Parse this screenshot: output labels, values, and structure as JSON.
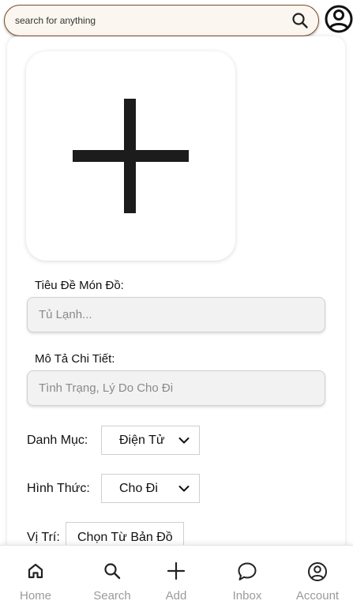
{
  "search": {
    "placeholder": "search for anything"
  },
  "icons": {
    "search": "search-icon",
    "account": "user-circle-icon",
    "upload": "plus-icon",
    "dropdown": "chevron-down-icon"
  },
  "form": {
    "title_label": "Tiêu Đề Món Đồ:",
    "title_placeholder": "Tủ Lạnh...",
    "description_label": "Mô Tả Chi Tiết:",
    "description_placeholder": "Tình Trạng, Lý Do Cho Đi",
    "category_label": "Danh Mục:",
    "category_value": "Điện Tử",
    "method_label": "Hình Thức:",
    "method_value": "Cho Đi",
    "location_label": "Vị Trí:",
    "location_button": "Chọn Từ Bản Đồ"
  },
  "nav": [
    {
      "label": "Home",
      "icon": "home-icon"
    },
    {
      "label": "Search",
      "icon": "search-icon"
    },
    {
      "label": "Add",
      "icon": "plus-icon"
    },
    {
      "label": "Inbox",
      "icon": "chat-bubble-icon"
    },
    {
      "label": "Account",
      "icon": "user-circle-icon"
    }
  ],
  "colors": {
    "search_border": "#7a4a2a",
    "search_background": "#fbf7f0",
    "nav_label": "#9a9a9a",
    "field_background": "#f2f2f2"
  }
}
